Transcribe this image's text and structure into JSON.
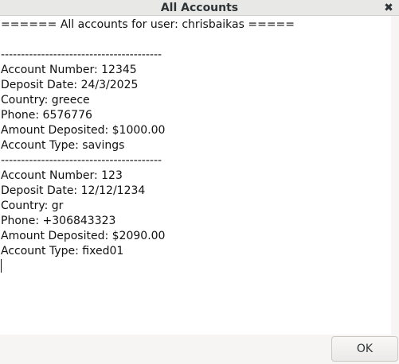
{
  "window": {
    "title": "All Accounts",
    "close_glyph": "✖"
  },
  "content": {
    "lines": [
      "====== All accounts for user: chrisbaikas =====",
      "",
      "----------------------------------------",
      "Account Number: 12345",
      "Deposit Date: 24/3/2025",
      "Country: greece",
      "Phone: 6576776",
      "Amount Deposited: $1000.00",
      "Account Type: savings",
      "----------------------------------------",
      "Account Number: 123",
      "Deposit Date: 12/12/1234",
      "Country: gr",
      "Phone: +306843323",
      "Amount Deposited: $2090.00",
      "Account Type: fixed01"
    ]
  },
  "buttons": {
    "ok_label": "OK"
  }
}
